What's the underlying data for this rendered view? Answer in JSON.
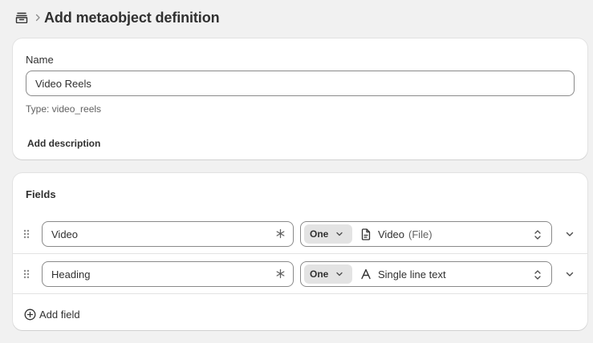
{
  "header": {
    "title": "Add metaobject definition",
    "home_icon": "metaobject-icon",
    "separator_icon": "chevron-right-icon"
  },
  "name_card": {
    "name_label": "Name",
    "name_value": "Video Reels",
    "type_hint": "Type: video_reels",
    "add_description_label": "Add description"
  },
  "fields_card": {
    "title": "Fields",
    "rows": [
      {
        "name": "Video",
        "cardinality": "One",
        "type_icon": "file-icon",
        "type_label": "Video",
        "type_sublabel": "(File)"
      },
      {
        "name": "Heading",
        "cardinality": "One",
        "type_icon": "text-icon",
        "type_label": "Single line text",
        "type_sublabel": ""
      }
    ],
    "add_field_label": "Add field"
  },
  "colors": {
    "background": "#f1f1f1",
    "card": "#ffffff",
    "text": "#303030",
    "subdued": "#616161",
    "border": "#8a8a8a",
    "pill": "#e3e3e3"
  }
}
